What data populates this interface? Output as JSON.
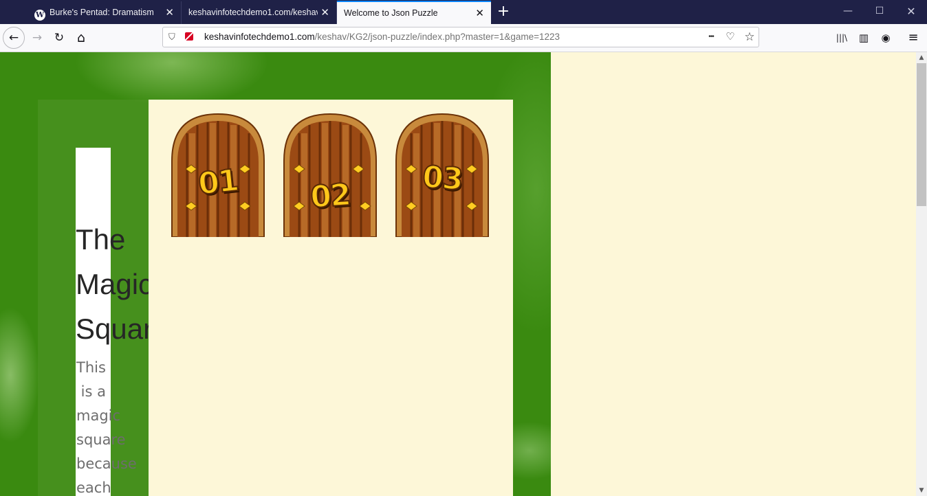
{
  "browser": {
    "tabs": [
      {
        "title": "Burke's Pentad: Dramatism",
        "icon": "wordpress-icon",
        "active": false
      },
      {
        "title": "keshavinfotechdemo1.com/keshav",
        "icon": "",
        "active": false
      },
      {
        "title": "Welcome to Json Puzzle",
        "icon": "",
        "active": true
      }
    ],
    "tab_close_glyph": "✕",
    "new_tab_glyph": "+",
    "url_domain": "keshavinfotechdemo1.com",
    "url_path": "/keshav/KG2/json-puzzle/index.php?master=1&game=1223",
    "window_controls": {
      "minimize": "—",
      "maximize": "☐",
      "close": "✕"
    },
    "glyphs": {
      "back": "←",
      "forward": "→",
      "reload": "↻",
      "home": "⌂",
      "more": "•••",
      "pocket": "♡",
      "star": "☆",
      "library": "|||\\",
      "sidebar": "▥",
      "account": "◉",
      "menu": "≡",
      "shield": "⛉"
    }
  },
  "page": {
    "heading": "The\nMagic\nSquare",
    "description": "This\n is a\nmagic\nsquare\nbecause\neach",
    "doors": [
      {
        "label": "01"
      },
      {
        "label": "02"
      },
      {
        "label": "03"
      }
    ],
    "colors": {
      "background": "#fdf7d8",
      "green": "#3a8a10",
      "door_wood": "#9b4a14",
      "door_number": "#ffc81a"
    }
  }
}
